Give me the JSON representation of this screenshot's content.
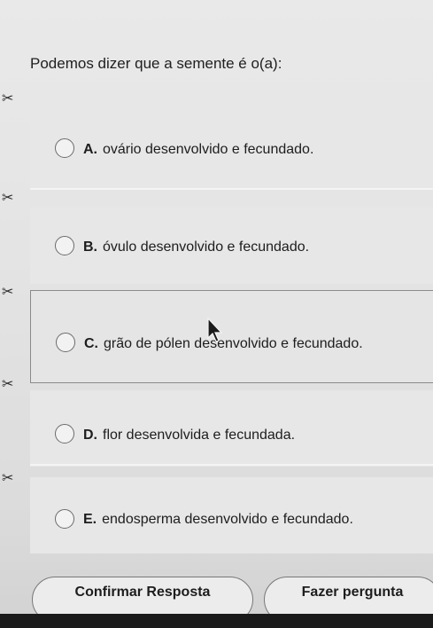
{
  "question": {
    "text": "Podemos dizer que a semente é o(a):"
  },
  "scissor_glyph": "✂",
  "options": [
    {
      "letter": "A.",
      "text": "ovário desenvolvido e fecundado."
    },
    {
      "letter": "B.",
      "text": "óvulo desenvolvido e fecundado."
    },
    {
      "letter": "C.",
      "text": "grão de pólen desenvolvido e fecundado."
    },
    {
      "letter": "D.",
      "text": "flor desenvolvida e fecundada."
    },
    {
      "letter": "E.",
      "text": "endosperma desenvolvido e fecundado."
    }
  ],
  "buttons": {
    "confirm_label": "Confirmar Resposta",
    "ask_label": "Fazer pergunta"
  },
  "colors": {
    "option_border_selected": "#8a8a8a",
    "bottom_bar": "#1a1a1a"
  }
}
